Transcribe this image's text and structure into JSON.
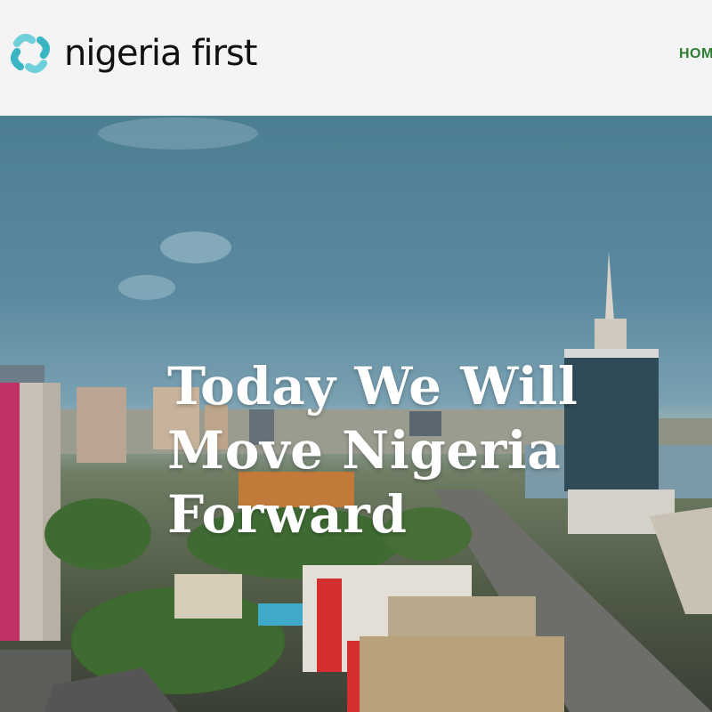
{
  "brand": {
    "name": "nigeria first",
    "colors": {
      "logo_teal": "#39b5c4",
      "nav_green": "#2e7d32",
      "header_bg": "#f4f4f4"
    }
  },
  "nav": {
    "items": [
      {
        "label": "HOM",
        "icon": ""
      }
    ]
  },
  "hero": {
    "headline": "Today We Will Move Nigeria Forward",
    "background": "city-skyline-photo"
  }
}
